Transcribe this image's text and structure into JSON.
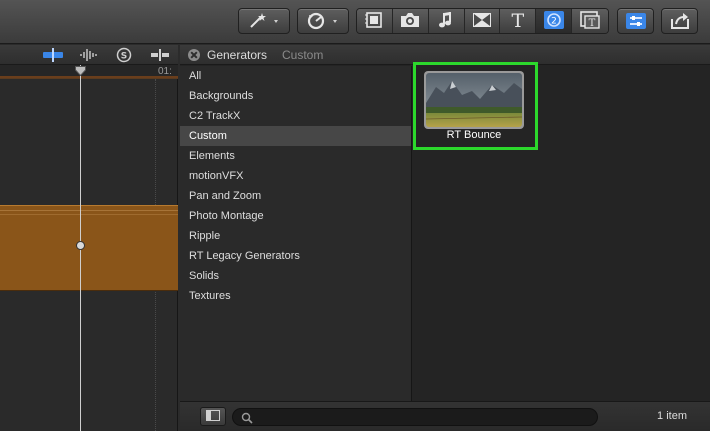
{
  "toolbar": {
    "left_group": [
      {
        "icon": "magic-wand-icon"
      },
      {
        "icon": "retime-icon"
      }
    ],
    "browser_buttons": [
      {
        "icon": "filmstrip-icon"
      },
      {
        "icon": "camera-icon"
      },
      {
        "icon": "music-note-icon"
      },
      {
        "icon": "transitions-icon"
      },
      {
        "icon": "title-icon",
        "glyph": "T"
      },
      {
        "icon": "generators-icon",
        "active": true
      },
      {
        "icon": "themes-icon"
      }
    ],
    "right_buttons": [
      {
        "icon": "inspector-icon"
      },
      {
        "icon": "share-icon"
      }
    ],
    "accent_color": "#3a86e8"
  },
  "timeline": {
    "ruler_timecode": "01:",
    "clip_color": "#8a5519"
  },
  "browser": {
    "title": "Generators",
    "subtitle": "Custom",
    "categories": [
      {
        "label": "All"
      },
      {
        "label": "Backgrounds"
      },
      {
        "label": "C2 TrackX"
      },
      {
        "label": "Custom",
        "selected": true
      },
      {
        "label": "Elements"
      },
      {
        "label": "motionVFX"
      },
      {
        "label": "Pan and Zoom"
      },
      {
        "label": "Photo Montage"
      },
      {
        "label": "Ripple"
      },
      {
        "label": "RT Legacy Generators"
      },
      {
        "label": "Solids"
      },
      {
        "label": "Textures"
      }
    ],
    "items": [
      {
        "label": "RT Bounce",
        "highlight_color": "#2cd82c"
      }
    ],
    "search": {
      "value": "",
      "placeholder": ""
    },
    "item_count": "1 item"
  }
}
